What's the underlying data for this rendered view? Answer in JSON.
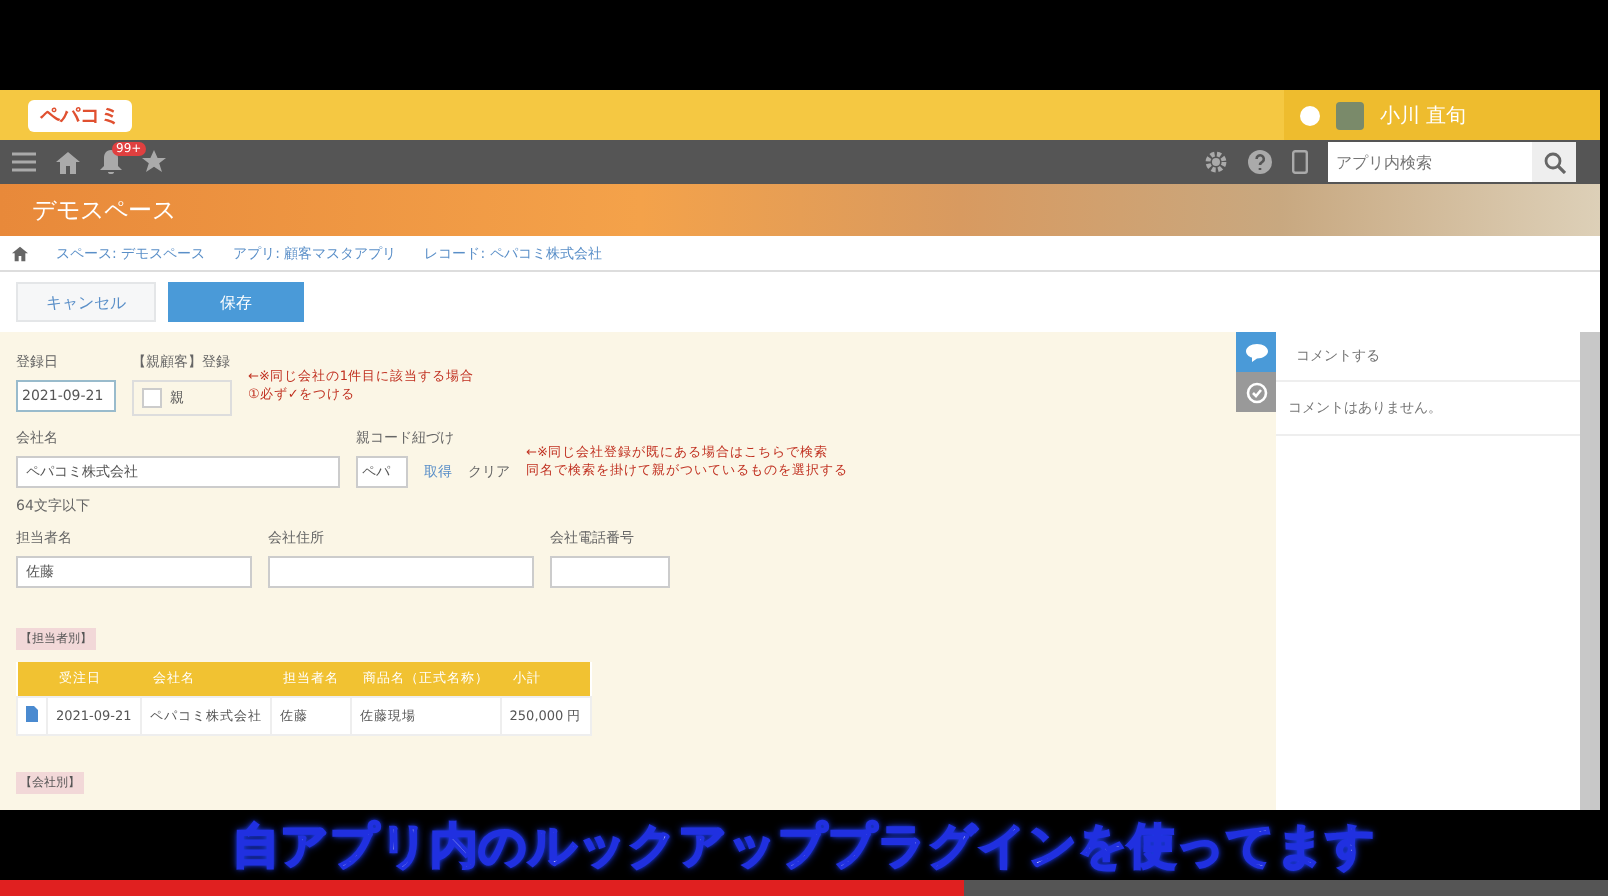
{
  "header": {
    "logo": "ペパコミ",
    "user_name": "小川 直旬"
  },
  "toolbar": {
    "notification_badge": "99+",
    "search": {
      "placeholder": "アプリ内検索"
    }
  },
  "banner": {
    "title": "デモスペース"
  },
  "breadcrumb": [
    "スペース: デモスペース",
    "アプリ: 顧客マスタアプリ",
    "レコード: ペパコミ株式会社"
  ],
  "actions": {
    "cancel": "キャンセル",
    "save": "保存"
  },
  "form": {
    "registered_date": {
      "label": "登録日",
      "value": "2021-09-21"
    },
    "parent_flag": {
      "label": "【親顧客】登録",
      "option": "親",
      "checked": false
    },
    "note_1": [
      "←※同じ会社の1件目に該当する場合",
      "①必ず✓をつける"
    ],
    "company_name": {
      "label": "会社名",
      "value": "ペパコミ株式会社",
      "hint": "64文字以下"
    },
    "parent_lookup": {
      "label": "親コード紐づけ",
      "value": "ペパ",
      "fetch": "取得",
      "clear": "クリア"
    },
    "note_2": [
      "←※同じ会社登録が既にある場合はこちらで検索",
      "同名で検索を掛けて親がついているものを選択する"
    ],
    "person": {
      "label": "担当者名",
      "value": "佐藤"
    },
    "address": {
      "label": "会社住所"
    },
    "phone": {
      "label": "会社電話番号"
    },
    "section_1": "【担当者別】",
    "table": {
      "columns": [
        "受注日",
        "会社名",
        "担当者名",
        "商品名（正式名称）",
        "小計"
      ],
      "rows": [
        [
          "2021-09-21",
          "ペパコミ株式会社",
          "佐藤",
          "佐藤現場",
          "250,000 円"
        ]
      ]
    },
    "section_2": "【会社別】"
  },
  "comments": {
    "input_placeholder": "コメントする",
    "empty": "コメントはありません。"
  },
  "caption": "自アプリ内のルックアッププラグインを使ってます",
  "video_progress": {
    "level": 0.6
  }
}
